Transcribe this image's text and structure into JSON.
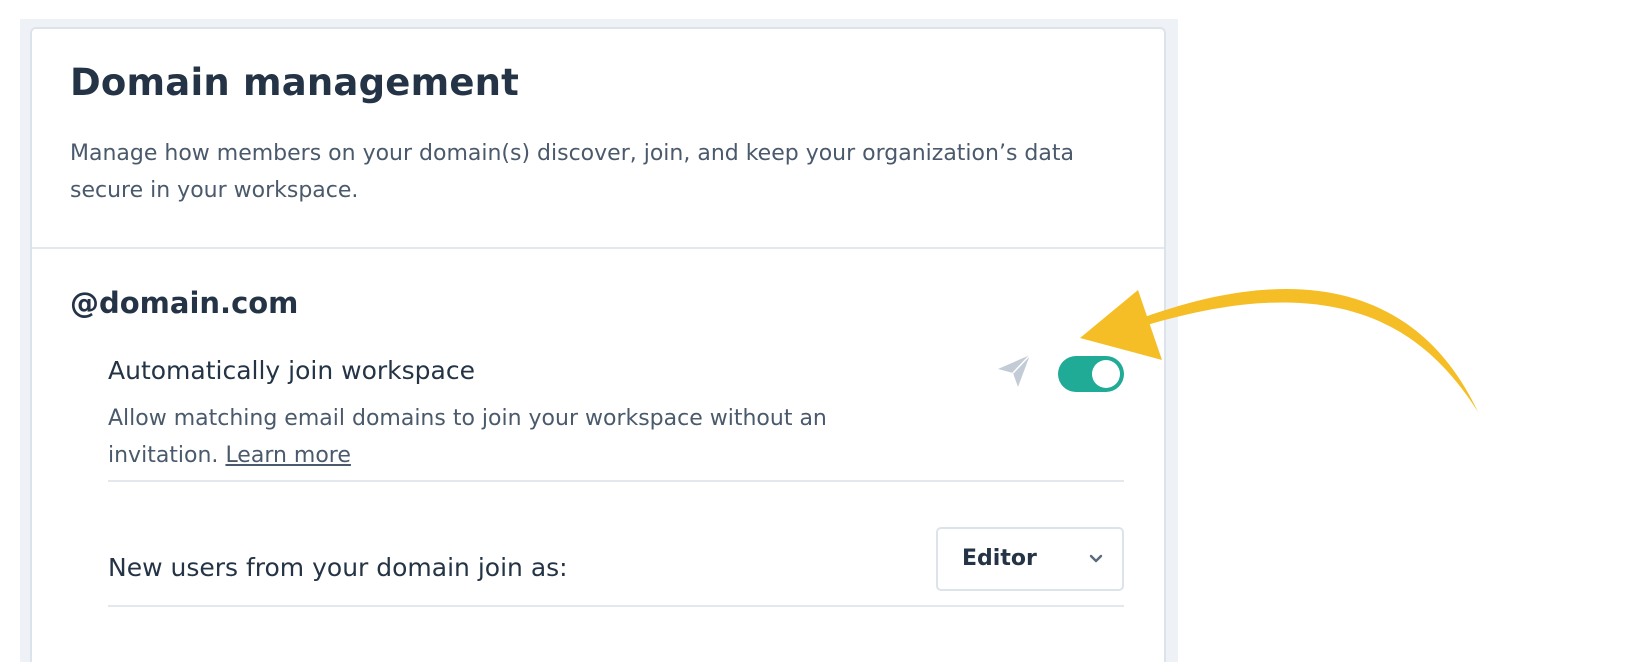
{
  "header": {
    "title": "Domain management",
    "subtitle": "Manage how members on your domain(s) discover, join, and keep your organization’s data secure in your workspace."
  },
  "domain": {
    "name": "@domain.com",
    "auto_join": {
      "title": "Automatically join workspace",
      "description": "Allow matching email domains to join your workspace without an invitation.",
      "learn_more_label": "Learn more",
      "enabled": true,
      "toggle_color": "#1fab96",
      "icon": "paper-plane-icon"
    },
    "join_role": {
      "label": "New users from your domain join as:",
      "selected": "Editor",
      "icon": "chevron-down-icon"
    }
  },
  "annotation": {
    "arrow_color": "#f5be27"
  }
}
